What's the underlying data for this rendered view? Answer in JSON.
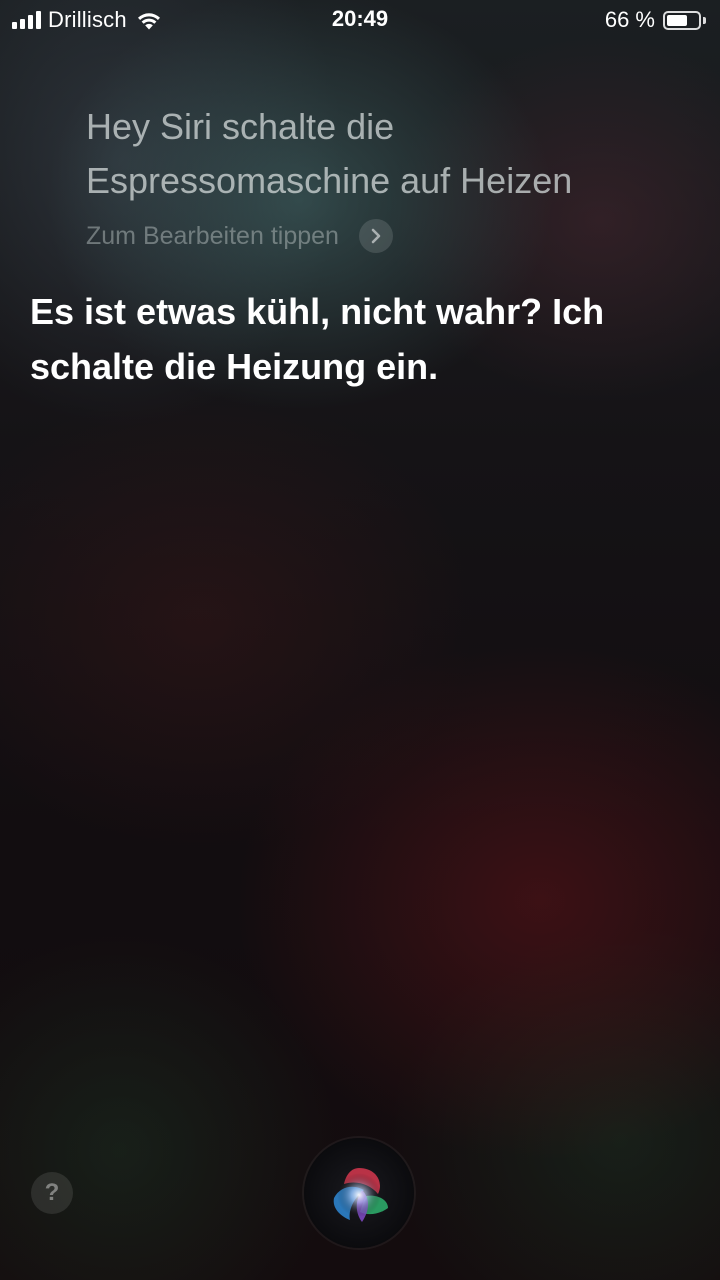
{
  "status_bar": {
    "carrier": "Drillisch",
    "time": "20:49",
    "battery_percent": "66 %",
    "battery_level": 0.66
  },
  "siri": {
    "query": "Hey Siri schalte die Espressomaschine auf Heizen",
    "edit_hint": "Zum Bearbeiten tippen",
    "response": "Es ist etwas kühl, nicht wahr? Ich schalte die Heizung ein.",
    "help_label": "?"
  },
  "icons": {
    "signal": "signal-bars-icon",
    "wifi": "wifi-icon",
    "battery": "battery-icon",
    "chevron": "chevron-right-icon",
    "siri": "siri-orb-icon"
  }
}
